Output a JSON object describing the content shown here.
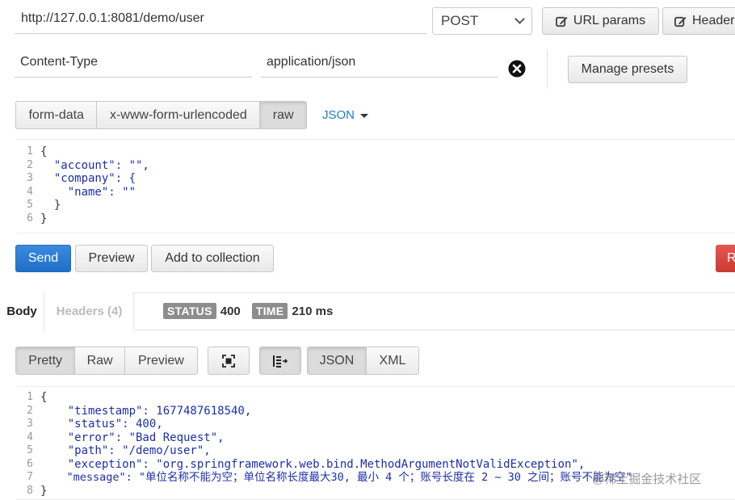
{
  "request": {
    "url": "http://127.0.0.1:8081/demo/user",
    "method": "POST",
    "url_params_label": "URL params",
    "headers_label": "Headers",
    "header_key": "Content-Type",
    "header_value": "application/json",
    "manage_presets_label": "Manage presets",
    "body_tabs": [
      "form-data",
      "x-www-form-urlencoded",
      "raw"
    ],
    "active_body_tab": "raw",
    "raw_format": "JSON",
    "body_lines": [
      {
        "n": "1",
        "text": "{"
      },
      {
        "n": "2",
        "text": "  \"account\": \"\","
      },
      {
        "n": "3",
        "text": "  \"company\": {"
      },
      {
        "n": "4",
        "text": "    \"name\": \"\""
      },
      {
        "n": "5",
        "text": "  }"
      },
      {
        "n": "6",
        "text": "}"
      }
    ],
    "send_label": "Send",
    "preview_label": "Preview",
    "add_collection_label": "Add to collection",
    "reset_label": "R"
  },
  "response": {
    "tab_body": "Body",
    "tab_headers": "Headers (4)",
    "status_label": "STATUS",
    "status_value": "400",
    "time_label": "TIME",
    "time_value": "210 ms",
    "view_tabs": [
      "Pretty",
      "Raw",
      "Preview"
    ],
    "active_view_tab": "Pretty",
    "format_tabs": [
      "JSON",
      "XML"
    ],
    "active_format_tab": "JSON",
    "body_lines": [
      {
        "n": "1",
        "text": "{"
      },
      {
        "n": "2",
        "text": "    \"timestamp\": 1677487618540,"
      },
      {
        "n": "3",
        "text": "    \"status\": 400,"
      },
      {
        "n": "4",
        "text": "    \"error\": \"Bad Request\","
      },
      {
        "n": "5",
        "text": "    \"path\": \"/demo/user\","
      },
      {
        "n": "6",
        "text": "    \"exception\": \"org.springframework.web.bind.MethodArgumentNotValidException\","
      },
      {
        "n": "7",
        "text": "    \"message\": \"单位名称不能为空；单位名称长度最大30, 最小 4 个；账号长度在 2 ~ 30 之间；账号不能为空\""
      },
      {
        "n": "8",
        "text": "}"
      }
    ]
  },
  "watermark": "@稀土掘金技术社区",
  "colors": {
    "send": "#2a7bd3",
    "reset": "#d9463e",
    "json_key": "#1c2fa8",
    "json_number": "#116644",
    "format_link": "#1a7ec4"
  }
}
